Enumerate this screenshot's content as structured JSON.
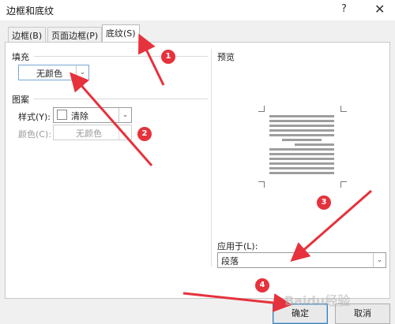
{
  "window": {
    "title": "边框和底纹",
    "help_glyph": "?",
    "close_glyph": "✕"
  },
  "tabs": [
    {
      "label": "边框(B)",
      "active": false
    },
    {
      "label": "页面边框(P)",
      "active": false
    },
    {
      "label": "底纹(S)",
      "active": true
    }
  ],
  "fill": {
    "label": "填充",
    "value": "无颜色",
    "arrow": "⌄"
  },
  "pattern": {
    "label": "图案",
    "style_label": "样式(Y):",
    "style_value": "清除",
    "color_label": "颜色(C):",
    "color_value": "无颜色",
    "arrow": "⌄"
  },
  "preview": {
    "label": "预览"
  },
  "apply_to": {
    "label": "应用于(L):",
    "value": "段落",
    "arrow": "⌄"
  },
  "buttons": {
    "ok": "确定",
    "cancel": "取消"
  },
  "annotations": {
    "steps": [
      "1",
      "2",
      "3",
      "4"
    ],
    "arrow_color": "#e5323c"
  },
  "watermark": "Baidu经验"
}
